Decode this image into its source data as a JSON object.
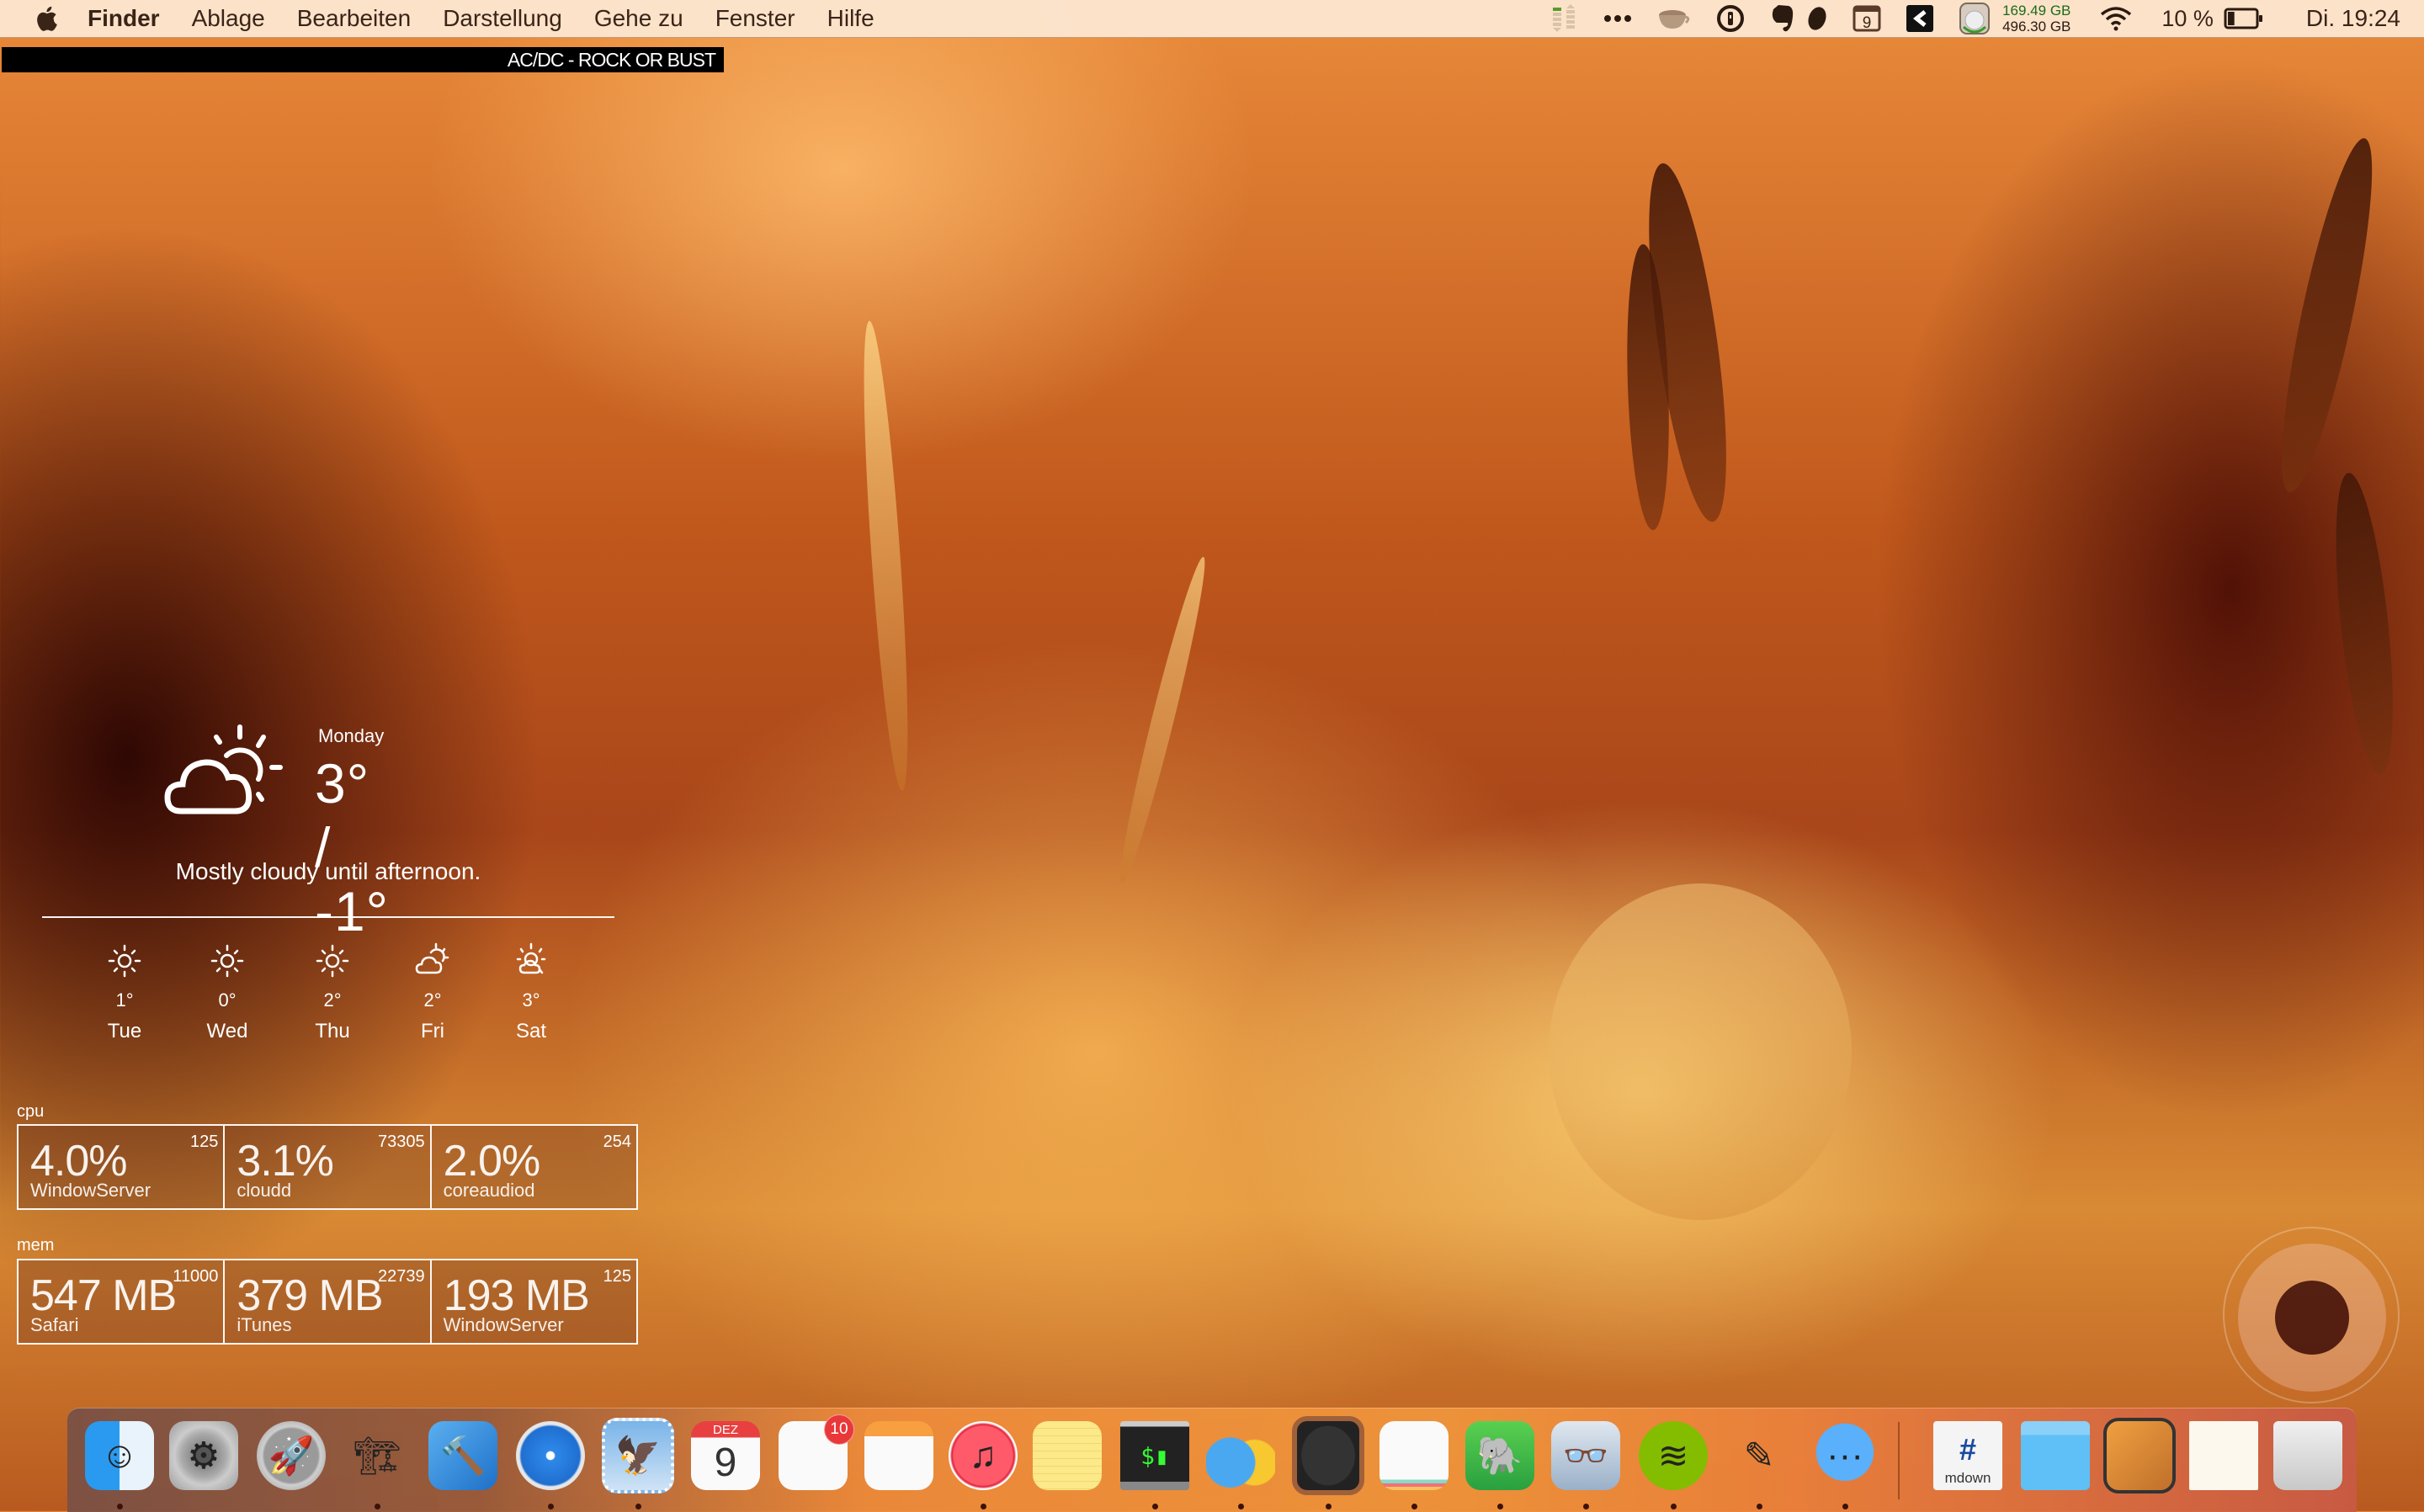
{
  "menubar": {
    "app_name": "Finder",
    "menus": [
      "Ablage",
      "Bearbeiten",
      "Darstellung",
      "Gehe zu",
      "Fenster",
      "Hilfe"
    ],
    "status_icons": [
      "activity-monitor-icon",
      "more-dots-icon",
      "caffeine-cup-icon",
      "1password-icon",
      "evernote-icon",
      "coffee-bean-icon",
      "calendar-day-icon",
      "kindle-k-icon",
      "disk-drive-icon"
    ],
    "calendar_day": "9",
    "disk_free": "169.49 GB",
    "disk_total": "496.30 GB",
    "battery_percent_label": "10 %",
    "battery_level": 0.1,
    "clock": "Di. 19:24"
  },
  "now_playing": {
    "text": "AC/DC - ROCK OR BUST"
  },
  "weather": {
    "day": "Monday",
    "temperature": "3° / -1°",
    "condition_icon": "partly-cloudy-icon",
    "description": "Mostly cloudy until afternoon.",
    "forecast": [
      {
        "day": "Tue",
        "temp": "1°",
        "icon": "sun-icon"
      },
      {
        "day": "Wed",
        "temp": "0°",
        "icon": "sun-icon"
      },
      {
        "day": "Thu",
        "temp": "2°",
        "icon": "sun-icon"
      },
      {
        "day": "Fri",
        "temp": "2°",
        "icon": "partly-cloudy-icon"
      },
      {
        "day": "Sat",
        "temp": "3°",
        "icon": "partly-cloudy-icon"
      }
    ]
  },
  "top": {
    "cpu_label": "cpu",
    "cpu": [
      {
        "value": "4.0%",
        "process": "WindowServer",
        "pid": "125"
      },
      {
        "value": "3.1%",
        "process": "cloudd",
        "pid": "73305"
      },
      {
        "value": "2.0%",
        "process": "coreaudiod",
        "pid": "254"
      }
    ],
    "mem_label": "mem",
    "mem": [
      {
        "value": "547 MB",
        "process": "Safari",
        "pid": "11000"
      },
      {
        "value": "379 MB",
        "process": "iTunes",
        "pid": "22739"
      },
      {
        "value": "193 MB",
        "process": "WindowServer",
        "pid": "125"
      }
    ]
  },
  "dock": {
    "apps": [
      {
        "name": "Finder",
        "icon": "finder-icon",
        "running": true
      },
      {
        "name": "System Preferences",
        "icon": "gear-icon",
        "running": false
      },
      {
        "name": "Launchpad",
        "icon": "rocket-icon",
        "running": false
      },
      {
        "name": "Archive Utility",
        "icon": "forklift-icon",
        "running": true
      },
      {
        "name": "Xcode",
        "icon": "xcode-hammer-icon",
        "running": false
      },
      {
        "name": "Safari",
        "icon": "compass-icon",
        "running": true
      },
      {
        "name": "Mail",
        "icon": "mail-stamp-icon",
        "running": true
      },
      {
        "name": "Calendar",
        "icon": "calendar-icon",
        "running": false,
        "month": "DEZ",
        "day": "9"
      },
      {
        "name": "Reminders",
        "icon": "reminders-icon",
        "running": false,
        "badge": "10"
      },
      {
        "name": "Pages",
        "icon": "pages-icon",
        "running": false
      },
      {
        "name": "iTunes",
        "icon": "music-note-icon",
        "running": true
      },
      {
        "name": "Notes",
        "icon": "notepad-icon",
        "running": false
      },
      {
        "name": "Terminal",
        "icon": "terminal-icon",
        "running": true
      },
      {
        "name": "CleanMyMac",
        "icon": "cleaner-bottles-icon",
        "running": true
      },
      {
        "name": "Scapple",
        "icon": "blackboard-icon",
        "running": true
      },
      {
        "name": "Pocket",
        "icon": "pocket-icon",
        "running": true
      },
      {
        "name": "Evernote",
        "icon": "evernote-elephant-icon",
        "running": true
      },
      {
        "name": "ReadKit",
        "icon": "readkit-glasses-icon",
        "running": true
      },
      {
        "name": "Spotify",
        "icon": "spotify-icon",
        "running": true
      },
      {
        "name": "Byword",
        "icon": "pencil-b-icon",
        "running": true
      },
      {
        "name": "Messages",
        "icon": "chat-bubble-icon",
        "running": true
      }
    ],
    "stacks": [
      {
        "name": "mdown",
        "icon": "markdown-file-icon",
        "label": "mdown"
      },
      {
        "name": "Downloads",
        "icon": "folder-icon"
      },
      {
        "name": "Preview",
        "icon": "preview-icon"
      },
      {
        "name": "Document",
        "icon": "document-thumbnail-icon"
      },
      {
        "name": "Trash",
        "icon": "trash-icon"
      }
    ]
  }
}
